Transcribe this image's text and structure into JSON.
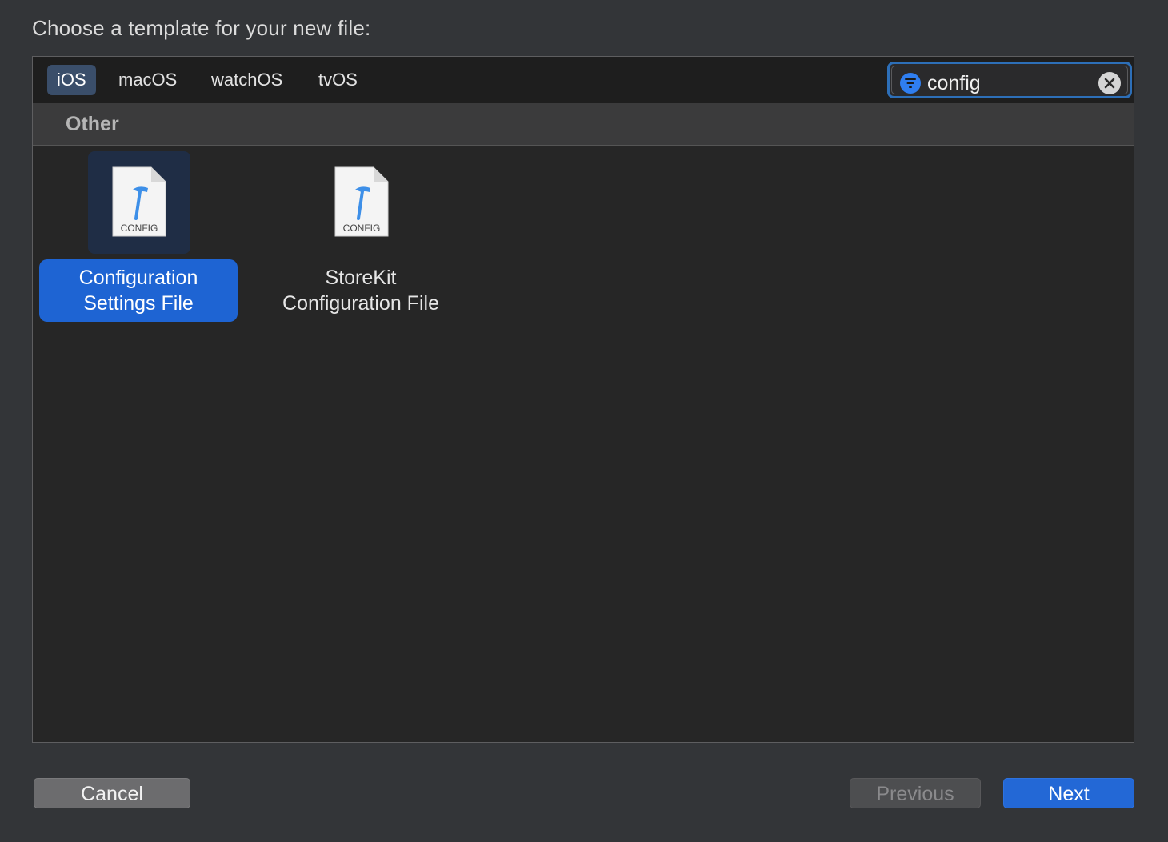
{
  "dialog": {
    "title": "Choose a template for your new file:"
  },
  "platform_tabs": [
    {
      "label": "iOS",
      "active": true
    },
    {
      "label": "macOS",
      "active": false
    },
    {
      "label": "watchOS",
      "active": false
    },
    {
      "label": "tvOS",
      "active": false
    }
  ],
  "search": {
    "value": "config",
    "filter_icon": "filter-icon",
    "clear_icon": "clear-icon"
  },
  "section": {
    "label": "Other"
  },
  "templates": [
    {
      "icon_caption": "CONFIG",
      "label_line1": "Configuration",
      "label_line2": "Settings File",
      "selected": true
    },
    {
      "icon_caption": "CONFIG",
      "label_line1": "StoreKit",
      "label_line2": "Configuration File",
      "selected": false
    }
  ],
  "buttons": {
    "cancel": "Cancel",
    "previous": "Previous",
    "next": "Next"
  },
  "colors": {
    "accent": "#1e64d3",
    "hammer": "#3d8fe8",
    "search_focus": "#2d6fb8"
  }
}
